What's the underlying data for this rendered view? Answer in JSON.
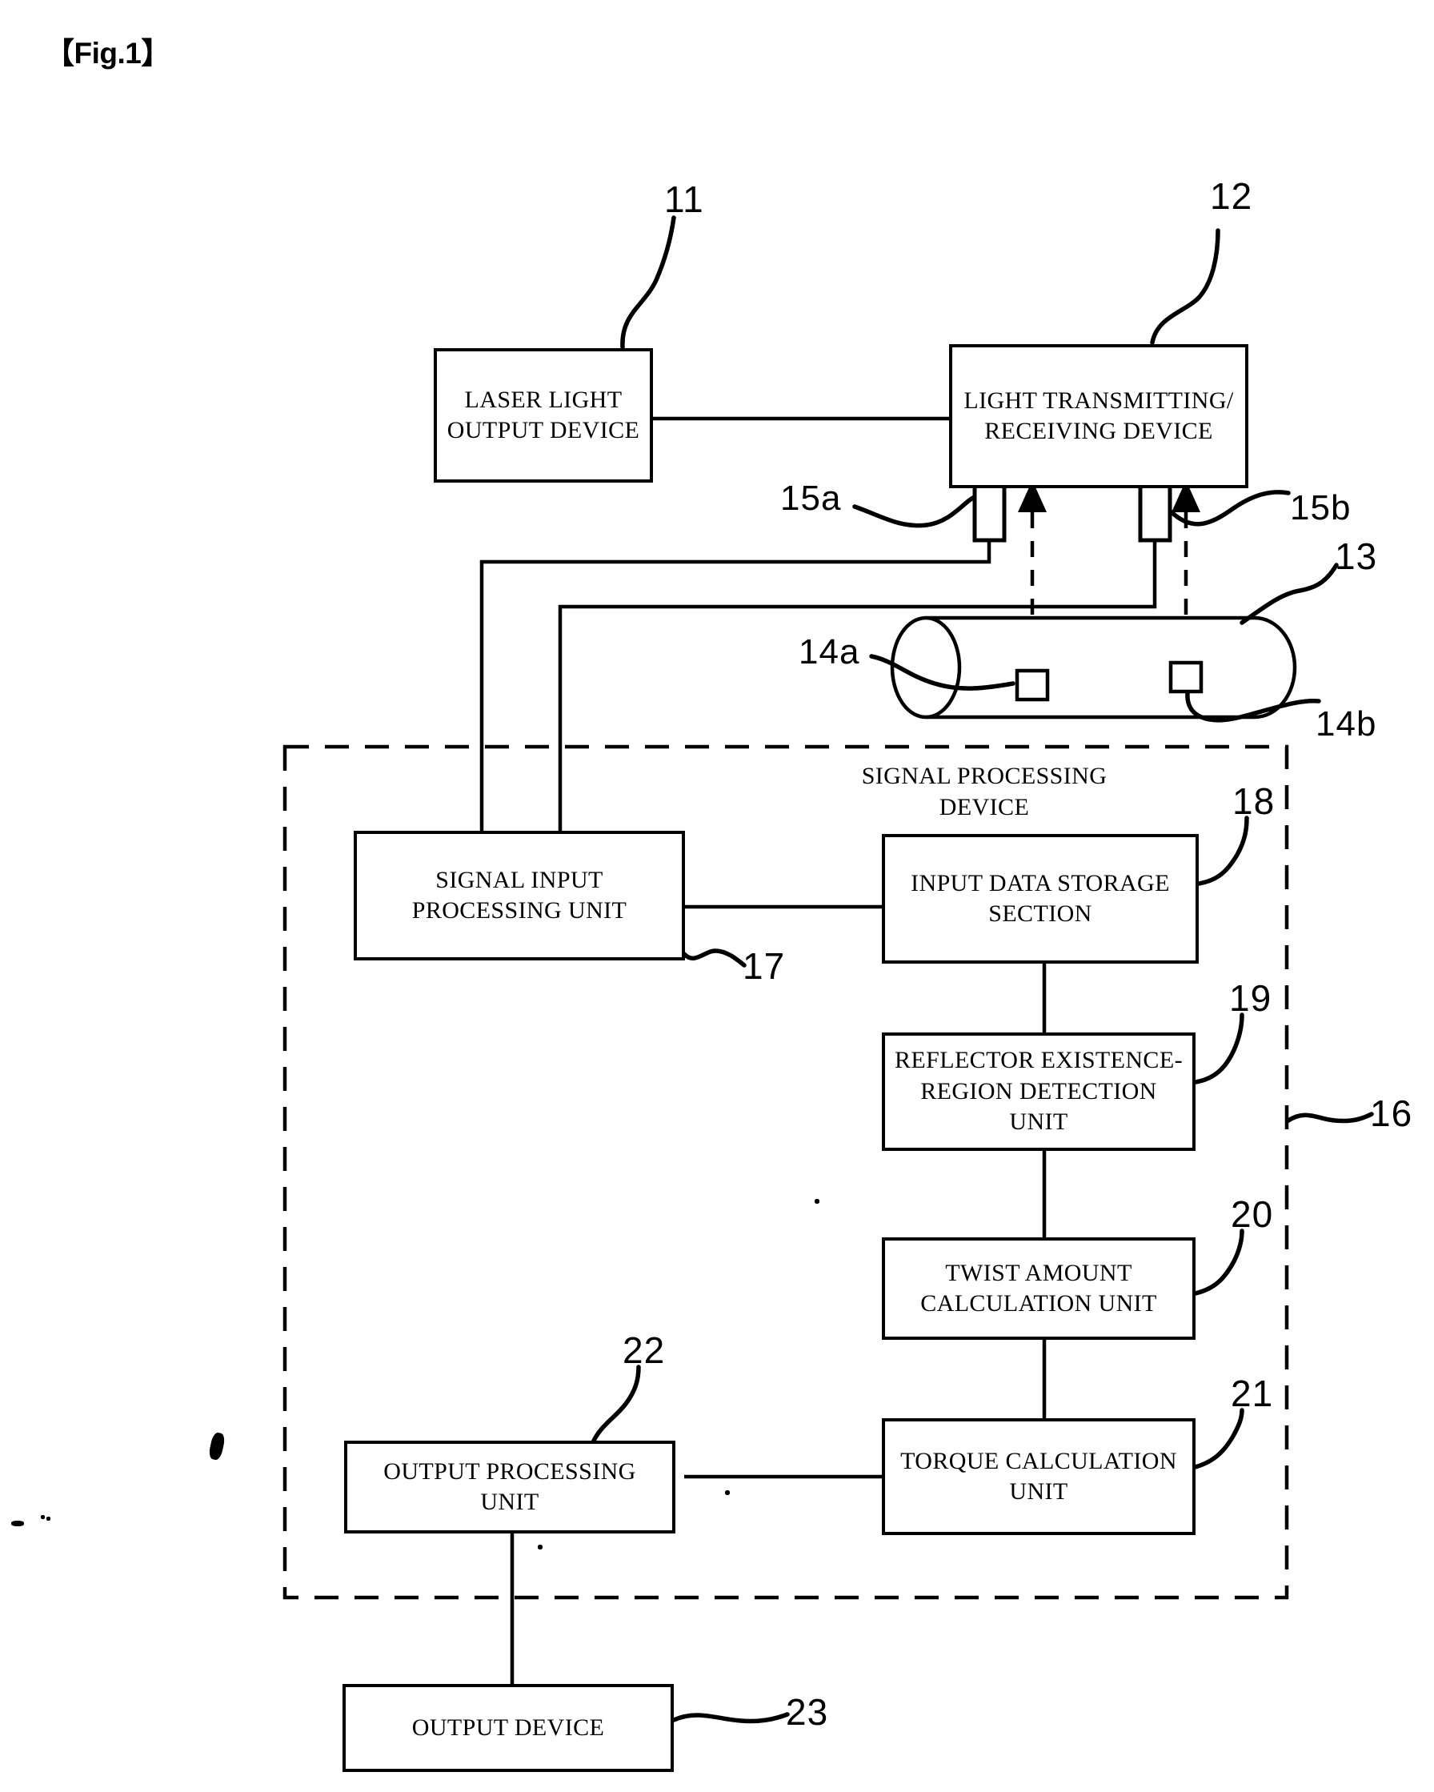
{
  "figure": {
    "label": "【Fig.1】"
  },
  "boxes": {
    "laser_light_output_device": "LASER LIGHT\nOUTPUT DEVICE",
    "light_transmitting_receiving_device": "LIGHT TRANSMITTING/\nRECEIVING DEVICE",
    "signal_input_processing_unit": "SIGNAL INPUT\nPROCESSING UNIT",
    "input_data_storage_section": "INPUT DATA STORAGE\nSECTION",
    "reflector_existence_region_detection_unit": "REFLECTOR EXISTENCE-\nREGION DETECTION UNIT",
    "twist_amount_calculation_unit": "TWIST AMOUNT\nCALCULATION UNIT",
    "torque_calculation_unit": "TORQUE CALCULATION\nUNIT",
    "output_processing_unit": "OUTPUT PROCESSING\nUNIT",
    "output_device": "OUTPUT DEVICE"
  },
  "group": {
    "signal_processing_device_title": "SIGNAL PROCESSING\nDEVICE"
  },
  "reference_numerals": {
    "laser_light_output_device": "11",
    "light_transmitting_receiving_device": "12",
    "shaft": "13",
    "reflector_a": "14a",
    "reflector_b": "14b",
    "probe_a": "15a",
    "probe_b": "15b",
    "signal_processing_device": "16",
    "signal_input_processing_unit": "17",
    "input_data_storage_section": "18",
    "reflector_existence_region_detection_unit": "19",
    "twist_amount_calculation_unit": "20",
    "torque_calculation_unit": "21",
    "output_processing_unit": "22",
    "output_device": "23"
  },
  "colors": {
    "ink": "#000000",
    "paper": "#ffffff"
  }
}
